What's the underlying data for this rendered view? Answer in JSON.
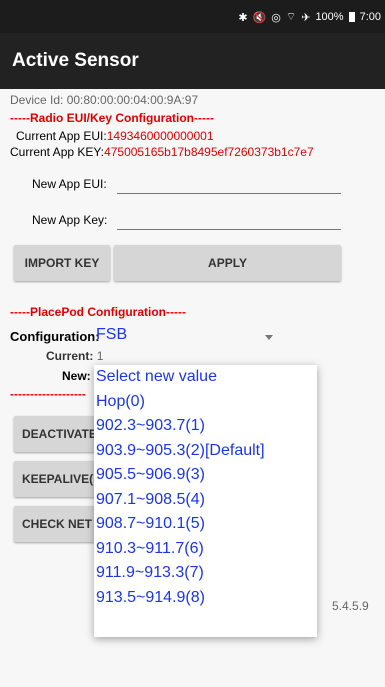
{
  "status": {
    "icons": [
      "bluetooth-icon",
      "mute-icon",
      "hotspot-icon",
      "wifi-icon",
      "airplane-icon"
    ],
    "battery": "100%",
    "time": "7:00"
  },
  "app": {
    "title": "Active Sensor"
  },
  "device": {
    "id_text": "Device Id: 00:80:00:00:04:00:9A:97"
  },
  "radio": {
    "header": "-----Radio EUI/Key Configuration-----",
    "current_eui_label": "Current App EUI:",
    "current_eui_value": "1493460000000001",
    "current_key_label": "Current App KEY:",
    "current_key_value": "475005165b17b8495ef7260373b1c7e7",
    "new_eui_label": "New App EUI:",
    "new_key_label": "New App Key:",
    "import_label": "IMPORT KEY",
    "apply_label": "APPLY"
  },
  "placepod": {
    "header": "-----PlacePod Configuration-----",
    "config_label": "Configuration:",
    "config_value": "FSB",
    "current_label": "Current:",
    "current_value": "1",
    "new_label": "New:",
    "separator": "-------------------",
    "deactivate_label": "DEACTIVATE",
    "keepalive_label": "KEEPALIVE(",
    "checknet_label": "CHECK NET"
  },
  "version": "5.4.5.9",
  "dropdown": {
    "items": [
      "Select new value",
      "Hop(0)",
      "902.3~903.7(1)",
      "903.9~905.3(2)[Default]",
      "905.5~906.9(3)",
      "907.1~908.5(4)",
      "908.7~910.1(5)",
      "910.3~911.7(6)",
      "911.9~913.3(7)",
      "913.5~914.9(8)"
    ]
  }
}
